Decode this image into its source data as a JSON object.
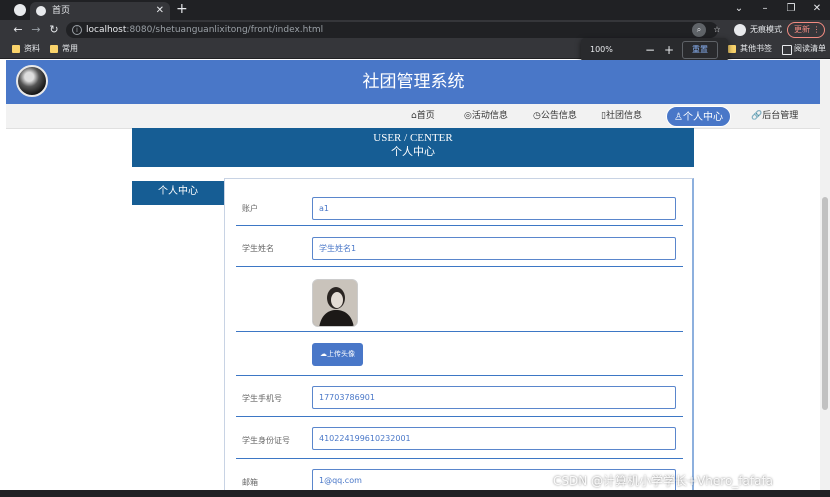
{
  "browser": {
    "tab_title": "首页",
    "url_host": "localhost",
    "url_rest": ":8080/shetuanguanlixitong/front/index.html",
    "incognito_label": "无痕模式",
    "update_label": "更新",
    "bookmarks": [
      "资料",
      "常用"
    ],
    "other_bookmarks": "其他书签",
    "reading_list": "阅读清单",
    "zoom": {
      "level": "100%",
      "reset_label": "重置"
    }
  },
  "site": {
    "title": "社团管理系统",
    "nav": [
      {
        "icon": "⌂",
        "label": "首页"
      },
      {
        "icon": "◎",
        "label": "活动信息"
      },
      {
        "icon": "◷",
        "label": "公告信息"
      },
      {
        "icon": "▯",
        "label": "社团信息"
      },
      {
        "icon": "♙",
        "label": "个人中心"
      },
      {
        "icon": "🔗",
        "label": "后台管理"
      }
    ],
    "banner": {
      "en": "USER / CENTER",
      "zh": "个人中心"
    },
    "sidebar_item": "个人中心"
  },
  "form": {
    "account": {
      "label": "账户",
      "value": "a1"
    },
    "student_name": {
      "label": "学生姓名",
      "value": "学生姓名1"
    },
    "upload_label": "上传头像",
    "phone": {
      "label": "学生手机号",
      "value": "17703786901"
    },
    "id_card": {
      "label": "学生身份证号",
      "value": "410224199610232001"
    },
    "email": {
      "label": "邮箱",
      "value": "1@qq.com"
    }
  },
  "watermark": "CSDN @计算机小学学长+Vhero_fafafa",
  "colors": {
    "header_blue": "#4977c8",
    "banner_blue": "#165d94"
  }
}
